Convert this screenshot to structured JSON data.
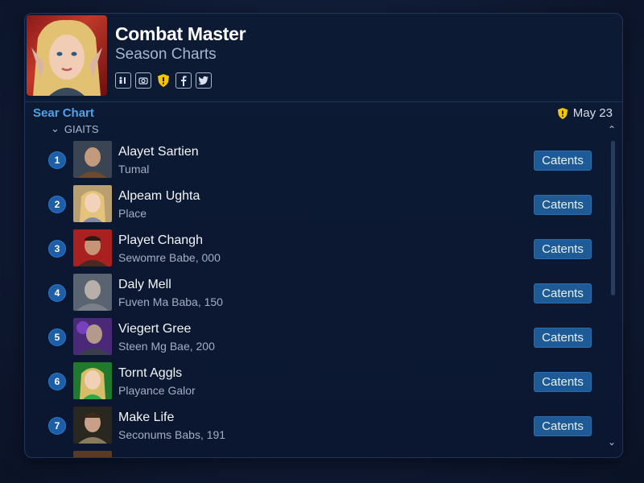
{
  "header": {
    "title": "Combat Master",
    "subtitle": "Season Charts",
    "social_icons": [
      "groups-icon",
      "camera-icon",
      "shield-icon",
      "facebook-icon",
      "twitter-icon"
    ]
  },
  "section": {
    "title": "Sear Chart",
    "date": "May 23",
    "sub_header": "GIAITS"
  },
  "players": [
    {
      "rank": "1",
      "name": "Alayet Sartien",
      "desc": "Tumal",
      "button": "Catents"
    },
    {
      "rank": "2",
      "name": "Alpeam Ughta",
      "desc": "Place",
      "button": "Catents"
    },
    {
      "rank": "3",
      "name": "Playet Changh",
      "desc": "Sewomre Babe, 000",
      "button": "Catents"
    },
    {
      "rank": "4",
      "name": "Daly Mell",
      "desc": "Fuven Ma Baba, 150",
      "button": "Catents"
    },
    {
      "rank": "5",
      "name": "Viegert Gree",
      "desc": "Steen Mg Bae, 200",
      "button": "Catents"
    },
    {
      "rank": "6",
      "name": "Tornt Aggls",
      "desc": "Playance Galor",
      "button": "Catents"
    },
    {
      "rank": "7",
      "name": "Make Life",
      "desc": "Seconums Babs, 191",
      "button": "Catents"
    }
  ],
  "colors": {
    "accent": "#4aa3ee",
    "button": "#1d5a96",
    "rank_badge": "#1c5fa8",
    "panel": "#0d1a34"
  }
}
